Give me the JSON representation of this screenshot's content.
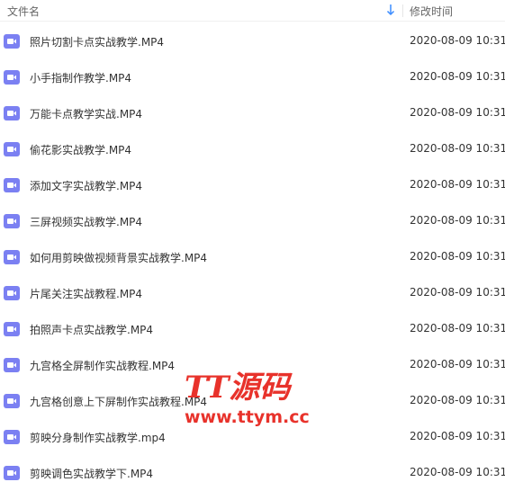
{
  "header": {
    "name_label": "文件名",
    "time_label": "修改时间"
  },
  "files": [
    {
      "name": "照片切割卡点实战教学.MP4",
      "modified": "2020-08-09 10:31"
    },
    {
      "name": "小手指制作教学.MP4",
      "modified": "2020-08-09 10:31"
    },
    {
      "name": "万能卡点教学实战.MP4",
      "modified": "2020-08-09 10:31"
    },
    {
      "name": "偷花影实战教学.MP4",
      "modified": "2020-08-09 10:31"
    },
    {
      "name": "添加文字实战教学.MP4",
      "modified": "2020-08-09 10:31"
    },
    {
      "name": "三屏视频实战教学.MP4",
      "modified": "2020-08-09 10:31"
    },
    {
      "name": "如何用剪映做视频背景实战教学.MP4",
      "modified": "2020-08-09 10:31"
    },
    {
      "name": "片尾关注实战教程.MP4",
      "modified": "2020-08-09 10:31"
    },
    {
      "name": "拍照声卡点实战教学.MP4",
      "modified": "2020-08-09 10:31"
    },
    {
      "name": "九宫格全屏制作实战教程.MP4",
      "modified": "2020-08-09 10:31"
    },
    {
      "name": "九宫格创意上下屏制作实战教程.MP4",
      "modified": "2020-08-09 10:31"
    },
    {
      "name": "剪映分身制作实战教学.mp4",
      "modified": "2020-08-09 10:31"
    },
    {
      "name": "剪映调色实战教学下.MP4",
      "modified": "2020-08-09 10:31"
    }
  ],
  "watermark": {
    "logo": "TT源码",
    "url": "www.ttym.cc"
  },
  "colors": {
    "video_icon": "#7b80f2",
    "sort_arrow": "#3b8cff",
    "watermark": "#e8322b"
  },
  "icons": {
    "file": "video-file-icon",
    "sort": "sort-down-arrow-icon"
  }
}
